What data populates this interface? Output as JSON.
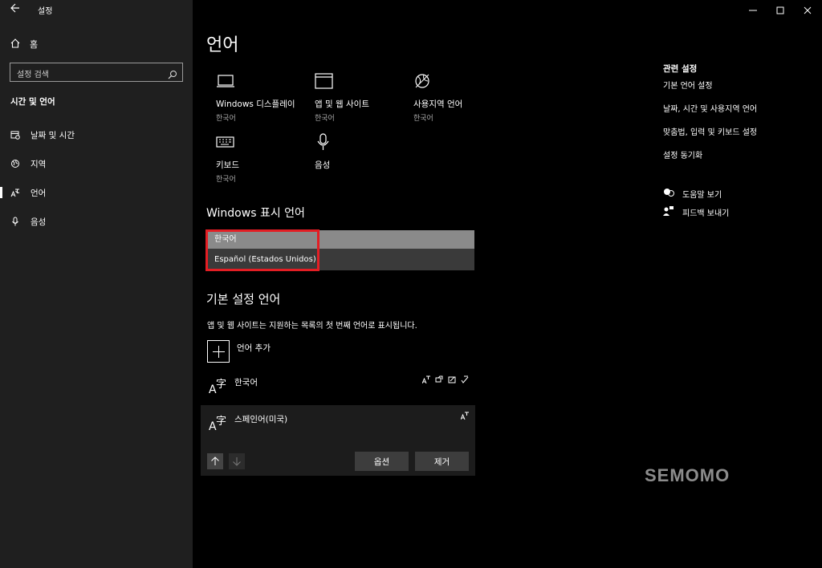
{
  "app": {
    "title": "설정",
    "back_icon": "back-arrow-icon"
  },
  "window_controls": {
    "minimize": "—",
    "maximize": "☐",
    "close": "✕"
  },
  "sidebar": {
    "home_label": "홈",
    "search_placeholder": "설정 검색",
    "section_title": "시간 및 언어",
    "items": [
      {
        "label": "날짜 및 시간",
        "icon": "calendar-clock-icon"
      },
      {
        "label": "지역",
        "icon": "globe-icon"
      },
      {
        "label": "언어",
        "icon": "language-icon",
        "active": true
      },
      {
        "label": "음성",
        "icon": "microphone-icon"
      }
    ]
  },
  "main": {
    "title": "언어",
    "tiles": [
      {
        "name": "Windows 디스플레이",
        "sub": "한국어",
        "icon": "laptop-icon"
      },
      {
        "name": "앱 및 웹 사이트",
        "sub": "한국어",
        "icon": "window-icon"
      },
      {
        "name": "사용지역 언어",
        "sub": "한국어",
        "icon": "globe-pin-icon"
      },
      {
        "name": "키보드",
        "sub": "한국어",
        "icon": "keyboard-icon"
      },
      {
        "name": "음성",
        "sub": "",
        "icon": "microphone-icon"
      }
    ],
    "display_language": {
      "heading": "Windows 표시 언어",
      "options": [
        "한국어",
        "Español (Estados Unidos)"
      ]
    },
    "preferred": {
      "heading": "기본 설정 언어",
      "description": "앱 및 웹 사이트는 지원하는 목록의 첫 번째 언어로 표시됩니다.",
      "add_label": "언어 추가",
      "languages": [
        {
          "name": "한국어"
        },
        {
          "name": "스페인어(미국)"
        }
      ],
      "options_button": "옵션",
      "remove_button": "제거"
    }
  },
  "related": {
    "title": "관련 설정",
    "links": [
      "기본 언어 설정",
      "날짜, 시간 및 사용지역 언어",
      "맞춤법, 입력 및 키보드 설정",
      "설정 동기화"
    ],
    "help": "도움말 보기",
    "feedback": "피드백 보내기"
  },
  "watermark": "SEMOMO",
  "colors": {
    "sidebar_bg": "#1f1f1f",
    "main_bg": "#000000",
    "highlight": "#e31e24"
  }
}
